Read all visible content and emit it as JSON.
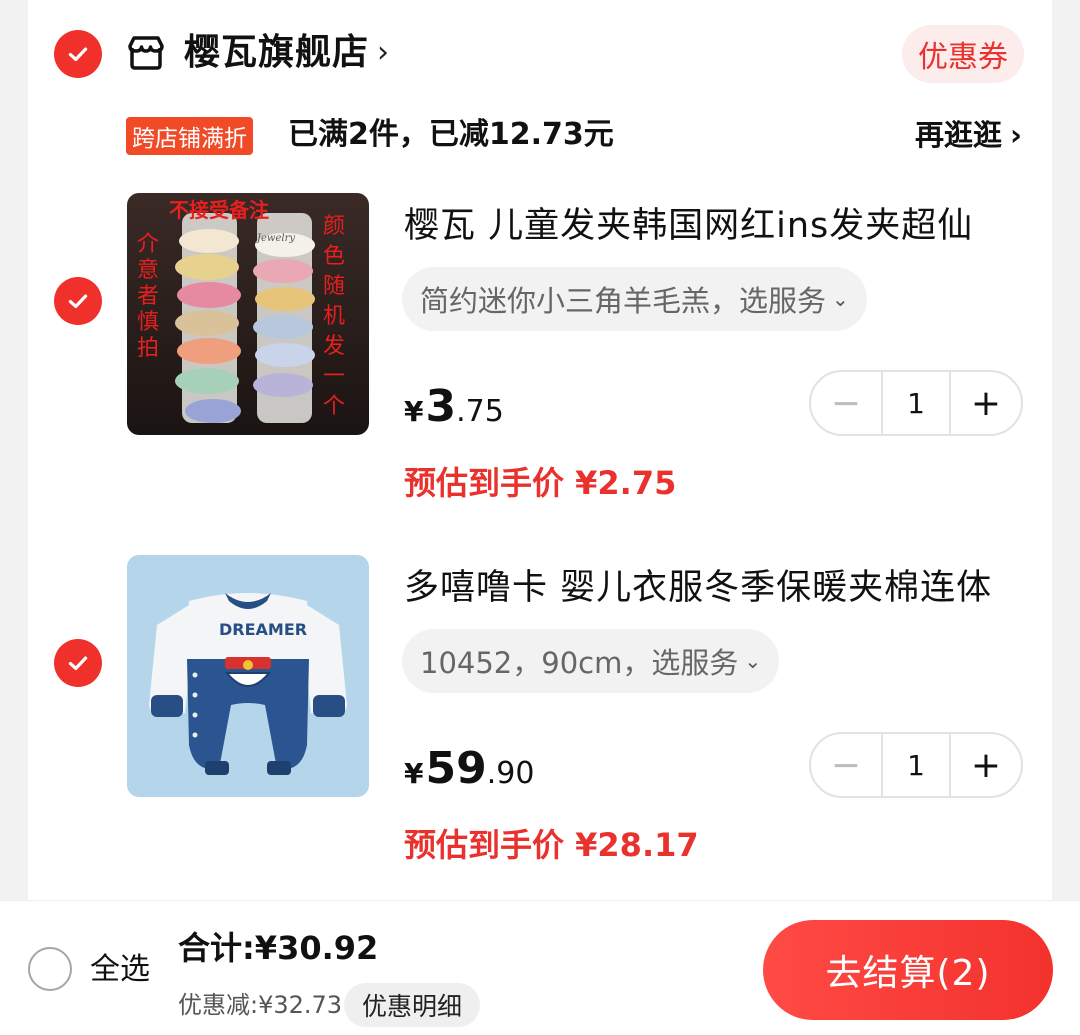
{
  "store": {
    "name": "樱瓦旗舰店",
    "chevron": "›",
    "coupon_label": "优惠券"
  },
  "promo": {
    "tag": "跨店铺满折",
    "text": "已满2件，已减12.73元",
    "link": "再逛逛",
    "link_chevron": "›"
  },
  "items": [
    {
      "title": "樱瓦 儿童发夹韩国网红ins发夹超仙",
      "sku": "简约迷你小三角羊毛羔，选服务",
      "price_symbol": "¥",
      "price_int": "3",
      "price_dec": ".75",
      "quantity": "1",
      "estimate": "预估到手价 ¥2.75",
      "image_overlay": {
        "top": "不接受备注",
        "left": "介意者慎拍",
        "right": "颜色随机发一个",
        "tag": "Jewelry"
      }
    },
    {
      "title": "多嘻噜卡 婴儿衣服冬季保暖夹棉连体",
      "sku": "10452，90cm，选服务",
      "price_symbol": "¥",
      "price_int": "59",
      "price_dec": ".90",
      "quantity": "1",
      "estimate": "预估到手价 ¥28.17",
      "image_overlay": {
        "chest": "DREAMER"
      }
    }
  ],
  "stepper": {
    "minus": "−",
    "plus": "+"
  },
  "bottom": {
    "select_all": "全选",
    "total": "合计:¥30.92",
    "discount": "优惠减:¥32.73",
    "detail_button": "优惠明细",
    "checkout": "去结算(2)"
  },
  "colors": {
    "accent": "#f0302a",
    "price_red": "#e9322d",
    "promo_orange": "#f04a27"
  }
}
